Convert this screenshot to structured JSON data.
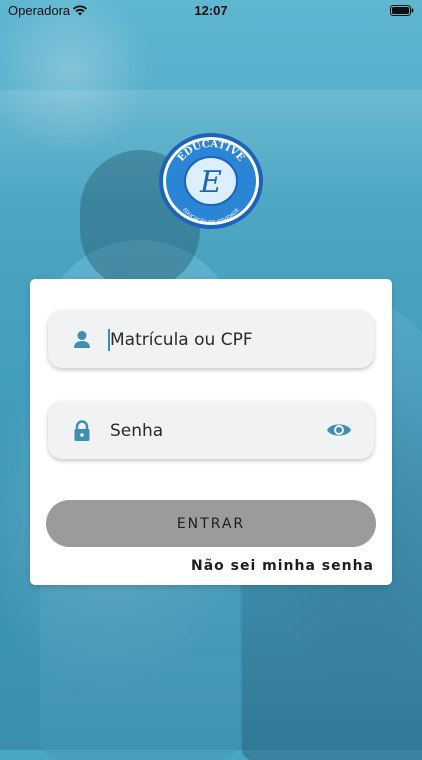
{
  "status_bar": {
    "carrier": "Operadora",
    "time": "12:07"
  },
  "logo": {
    "brand": "EDUCATIVE",
    "initial": "E",
    "tagline": "EDUCAÇÃO EM ATIVIDADE"
  },
  "login": {
    "username": {
      "placeholder": "Matrícula ou CPF",
      "icon": "user-icon"
    },
    "password": {
      "placeholder": "Senha",
      "icon": "lock-icon",
      "toggle_icon": "eye-icon"
    },
    "submit_label": "ENTRAR",
    "forgot_label": "Não sei minha senha"
  },
  "colors": {
    "accent": "#3d8fb0",
    "button_bg": "#9b9b9b",
    "overlay": "#4aa7c3",
    "logo_blue": "#1d63b8"
  }
}
